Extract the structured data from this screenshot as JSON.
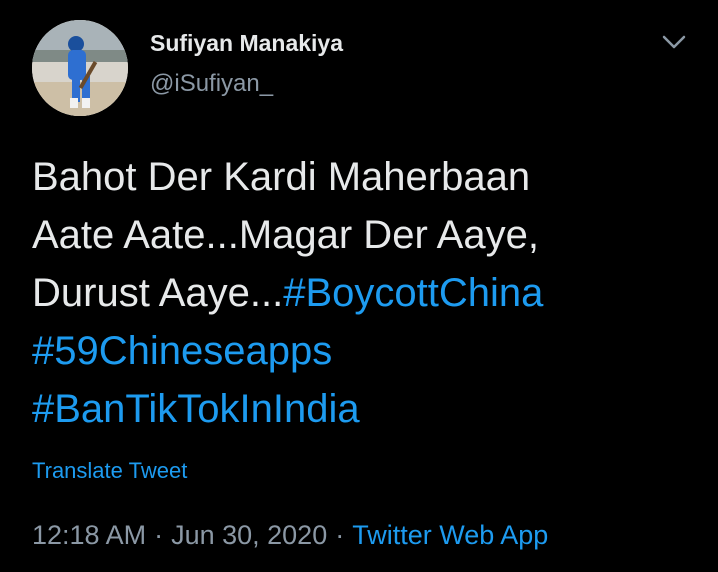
{
  "tweet": {
    "author": {
      "display_name": "Sufiyan Manakiya",
      "handle": "@iSufiyan_",
      "avatar_icon": "profile-photo-cricketer"
    },
    "menu_icon": "chevron-down-icon",
    "text": {
      "line1": "Bahot Der Kardi Maherbaan",
      "line2": "Aate Aate...Magar Der Aaye,",
      "line3_prefix": "Durust Aaye...",
      "hashtags": [
        "#BoycottChina",
        "#59Chineseapps",
        "#BanTikTokInIndia"
      ]
    },
    "translate_label": "Translate Tweet",
    "meta": {
      "time": "12:18 AM",
      "date": "Jun 30, 2020",
      "separator": "·",
      "source": "Twitter Web App"
    }
  },
  "colors": {
    "background": "#000000",
    "text": "#e7e9ea",
    "secondary": "#8b98a5",
    "accent": "#1d9bf0"
  }
}
